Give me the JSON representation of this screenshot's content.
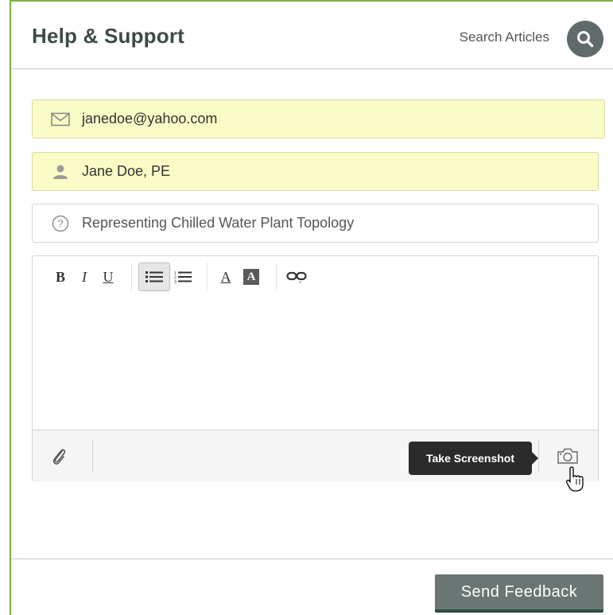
{
  "header": {
    "title": "Help & Support",
    "search_label": "Search Articles",
    "search_icon": "search-icon"
  },
  "form": {
    "email": {
      "value": "janedoe@yahoo.com",
      "icon": "envelope-icon",
      "autofilled": true
    },
    "name": {
      "value": "Jane Doe, PE",
      "icon": "person-icon",
      "autofilled": true
    },
    "subject": {
      "value": "Representing Chilled Water Plant Topology",
      "icon": "question-circle-icon"
    }
  },
  "editor": {
    "toolbar": {
      "bold": "B",
      "italic": "I",
      "underline": "U",
      "bulleted_list_icon": "bulleted-list-icon",
      "numbered_list_icon": "numbered-list-icon",
      "text_color": "A",
      "background_color": "A",
      "link_icon": "link-icon"
    },
    "body": "",
    "footer": {
      "attach_icon": "paperclip-icon",
      "tooltip": "Take Screenshot",
      "screenshot_icon": "camera-icon"
    }
  },
  "actions": {
    "send_label": "Send Feedback"
  },
  "colors": {
    "accent_border": "#7cb342",
    "autofill_bg": "#fafcc6",
    "button_bg": "#6b7574",
    "tooltip_bg": "#2b2b2b"
  }
}
